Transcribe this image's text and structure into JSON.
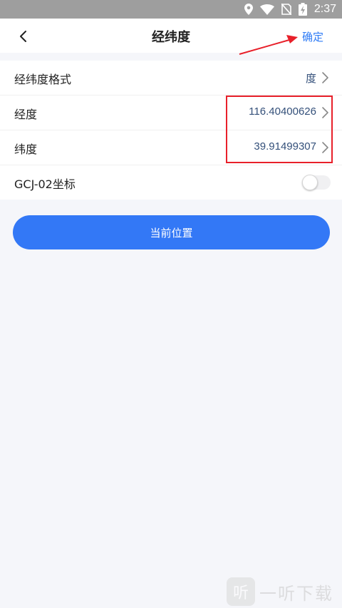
{
  "status_bar": {
    "time": "2:37",
    "icons": [
      "location-icon",
      "wifi-icon",
      "no-sim-icon",
      "battery-charging-icon"
    ]
  },
  "navbar": {
    "back_icon": "chevron-left-icon",
    "title": "经纬度",
    "confirm_label": "确定"
  },
  "settings": {
    "format": {
      "label": "经纬度格式",
      "value": "度"
    },
    "longitude": {
      "label": "经度",
      "value": "116.40400626"
    },
    "latitude": {
      "label": "纬度",
      "value": "39.91499307"
    },
    "gcj02": {
      "label": "GCJ-02坐标",
      "enabled": false
    }
  },
  "actions": {
    "current_location_label": "当前位置"
  },
  "watermark": {
    "logo_char": "听",
    "text": "一听下载"
  },
  "colors": {
    "accent": "#2f7cf6",
    "button": "#3378f6",
    "value_text": "#34507a",
    "annotation": "#e8202a",
    "background": "#f5f6fa"
  }
}
